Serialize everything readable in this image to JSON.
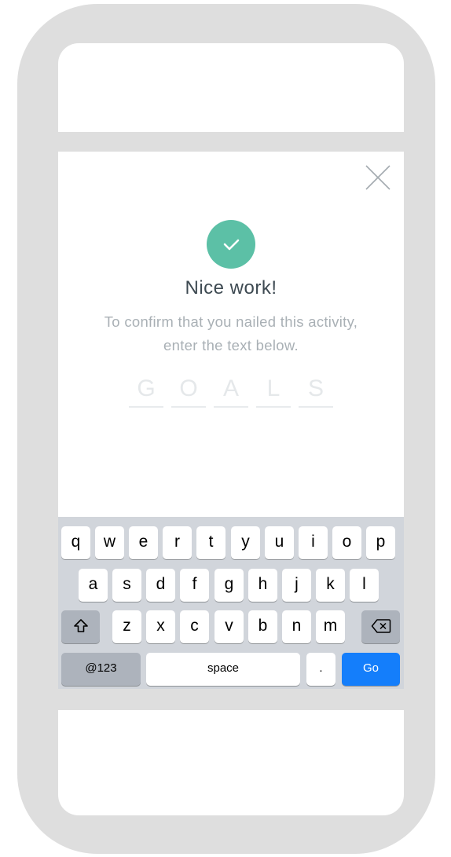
{
  "modal": {
    "title": "Nice work!",
    "subtitle": "To confirm that you nailed this activity, enter the text below.",
    "code_letters": [
      "G",
      "O",
      "A",
      "L",
      "S"
    ]
  },
  "keyboard": {
    "row1": [
      "q",
      "w",
      "e",
      "r",
      "t",
      "y",
      "u",
      "i",
      "o",
      "p"
    ],
    "row2": [
      "a",
      "s",
      "d",
      "f",
      "g",
      "h",
      "j",
      "k",
      "l"
    ],
    "row3": [
      "z",
      "x",
      "c",
      "v",
      "b",
      "n",
      "m"
    ],
    "numbers_label": "@123",
    "space_label": "space",
    "period_label": ".",
    "go_label": "Go"
  },
  "colors": {
    "accent": "#5cc0a6",
    "go_key": "#147efb",
    "device_frame": "#dedede",
    "keyboard_bg": "#d1d5db"
  },
  "icons": {
    "close": "close-icon",
    "check": "check-icon",
    "shift": "shift-icon",
    "backspace": "backspace-icon"
  }
}
